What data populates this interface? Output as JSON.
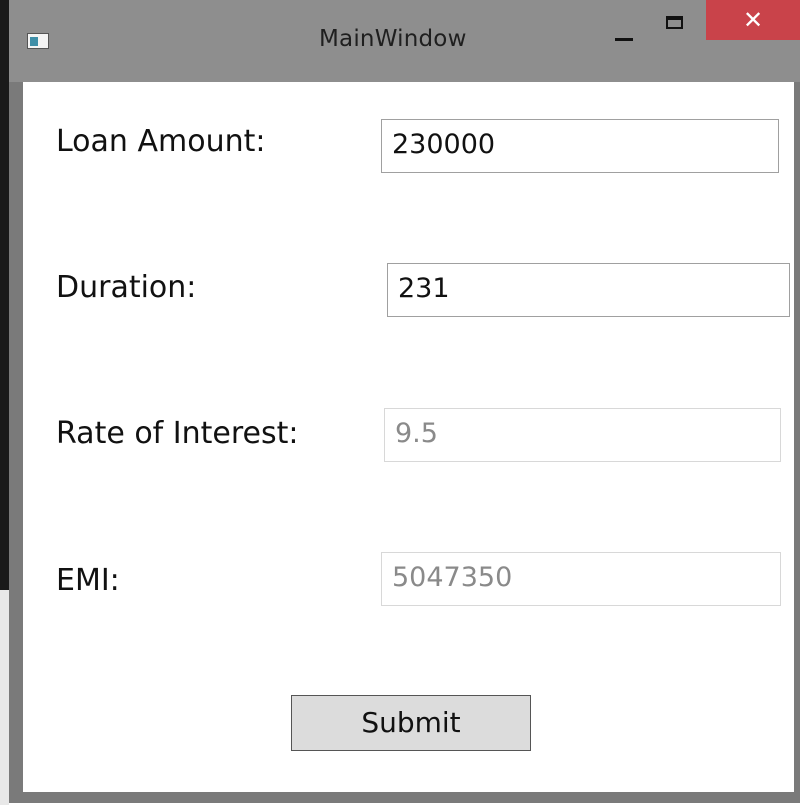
{
  "window": {
    "title": "MainWindow",
    "close_glyph": "✕",
    "icons": {
      "app": "app-icon",
      "minimize": "minimize-icon",
      "maximize": "maximize-icon",
      "close": "close-icon"
    },
    "close_color": "#c9434a"
  },
  "form": {
    "loan_amount": {
      "label": "Loan Amount:",
      "value": "230000"
    },
    "duration": {
      "label": "Duration:",
      "value": "231"
    },
    "rate_of_interest": {
      "label": "Rate of Interest:",
      "value": "9.5"
    },
    "emi": {
      "label": "EMI:",
      "value": "5047350"
    },
    "submit_label": "Submit"
  }
}
